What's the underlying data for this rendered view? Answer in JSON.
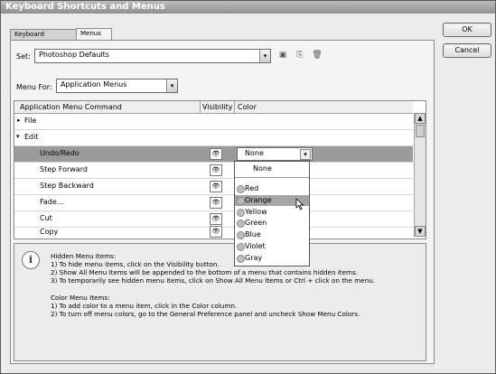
{
  "window": {
    "title": "Keyboard Shortcuts and Menus"
  },
  "buttons": {
    "ok": "OK",
    "cancel": "Cancel"
  },
  "tabs": [
    {
      "label": "Keyboard Shortcuts"
    },
    {
      "label": "Menus"
    }
  ],
  "set": {
    "label": "Set:",
    "value": "Photoshop Defaults"
  },
  "menu_for": {
    "label": "Menu For:",
    "value": "Application Menus"
  },
  "table": {
    "headers": {
      "command": "Application Menu Command",
      "visibility": "Visibility",
      "color": "Color"
    },
    "groups": [
      {
        "label": "File"
      },
      {
        "label": "Edit"
      }
    ],
    "rows": [
      {
        "label": "Undo/Redo",
        "color": "None"
      },
      {
        "label": "Step Forward",
        "color": ""
      },
      {
        "label": "Step Backward",
        "color": ""
      },
      {
        "label": "Fade...",
        "color": ""
      },
      {
        "label": "Cut",
        "color": ""
      },
      {
        "label": "Copy",
        "color": ""
      }
    ]
  },
  "color_dropdown": {
    "options": [
      {
        "label": "None"
      },
      {
        "label": "Red"
      },
      {
        "label": "Orange"
      },
      {
        "label": "Yellow"
      },
      {
        "label": "Green"
      },
      {
        "label": "Blue"
      },
      {
        "label": "Violet"
      },
      {
        "label": "Gray"
      }
    ],
    "highlighted": "Orange"
  },
  "info": {
    "lines": [
      "Hidden Menu Items:",
      "1) To hide menu items, click on the Visibility button.",
      "2) Show All Menu Items will be appended to the bottom of a menu that contains hidden items.",
      "3) To temporarily see hidden menu items, click on Show All Menu Items or Ctrl + click on the menu.",
      "",
      "Color Menu Items:",
      "1) To add color to a menu item, click in the Color column.",
      "2) To turn off menu colors, go to the General Preference panel and uncheck Show Menu Colors."
    ]
  }
}
